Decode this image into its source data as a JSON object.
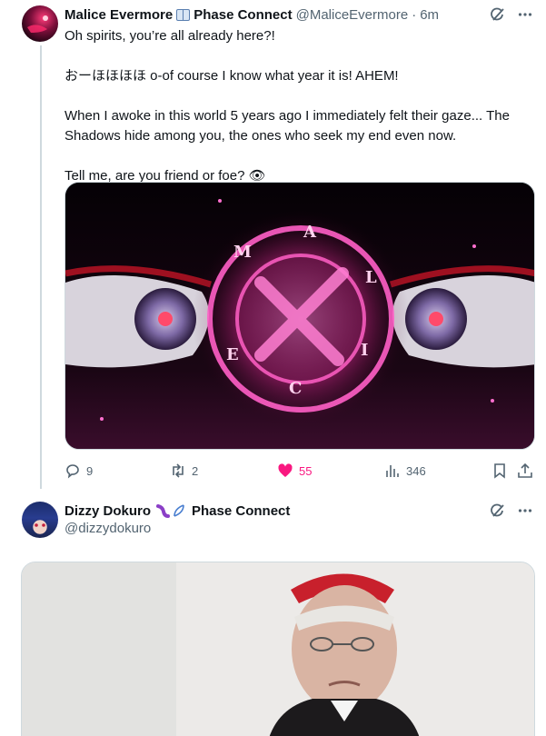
{
  "tweets": [
    {
      "display_name": "Malice Evermore",
      "affiliation": "Phase Connect",
      "handle": "@MaliceEvermore",
      "separator": "·",
      "time": "6m",
      "text_lines": [
        "Oh spirits, you’re all already here?!",
        "",
        "おーほほほほ o-of course I know what year it is! AHEM!",
        "",
        "When I awoke in this world 5 years ago  I immediately felt their gaze... The Shadows hide among you, the ones who seek my end even now.",
        "",
        "Tell me, are you friend or foe? 👁"
      ],
      "media_letters": [
        "M",
        "A",
        "L",
        "I",
        "C",
        "E"
      ],
      "actions": {
        "replies": "9",
        "reposts": "2",
        "likes": "55",
        "views": "346"
      }
    },
    {
      "display_name": "Dizzy Dokuro",
      "affiliation": "Phase Connect",
      "handle": "@dizzydokuro"
    }
  ],
  "icons": {
    "grok": "grok-icon",
    "more": "more-icon",
    "reply": "reply-icon",
    "repost": "repost-icon",
    "like": "heart-icon",
    "views": "views-icon",
    "bookmark": "bookmark-icon",
    "share": "share-icon"
  },
  "colors": {
    "like": "#f91880",
    "muted": "#536471",
    "text": "#0f1419",
    "border": "#cfd9de",
    "magic": "#ff3fb4"
  }
}
